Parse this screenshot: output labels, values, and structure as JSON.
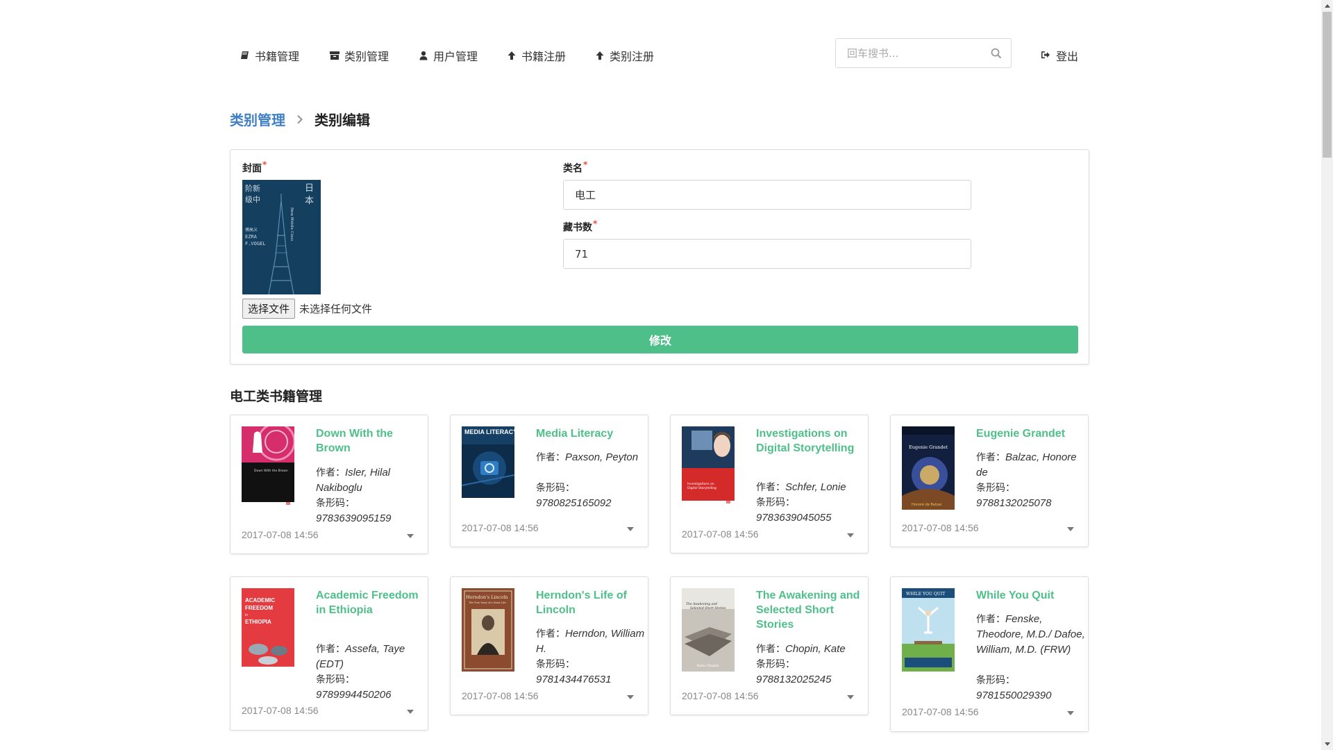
{
  "nav": {
    "items": [
      {
        "label": "书籍管理",
        "icon": "book-icon"
      },
      {
        "label": "类别管理",
        "icon": "archive-icon"
      },
      {
        "label": "用户管理",
        "icon": "user-icon"
      },
      {
        "label": "书籍注册",
        "icon": "arrow-up-icon"
      },
      {
        "label": "类别注册",
        "icon": "arrow-up-icon"
      }
    ],
    "search_placeholder": "回车搜书...",
    "logout_label": "登出"
  },
  "breadcrumb": {
    "parent": "类别管理",
    "current": "类别编辑"
  },
  "form": {
    "cover_label": "封面",
    "file_button": "选择文件",
    "file_status": "未选择任何文件",
    "name_label": "类名",
    "name_value": "电工",
    "count_label": "藏书数",
    "count_value": "71",
    "submit_label": "修改",
    "required_mark": "*",
    "cover_text": {
      "cn_title": "日本新中产阶级",
      "en_title": "Japan's New Middle Class",
      "author": "EZRA F.VOGEL",
      "author_cn": "傅高义"
    }
  },
  "section_title": "电工类书籍管理",
  "labels": {
    "author": "作者：",
    "barcode": "条形码："
  },
  "books": [
    {
      "title": "Down With the Brown",
      "author": "Isler, Hilal Nakiboglu",
      "barcode": "9783639095159",
      "date": "2017-07-08 14:56"
    },
    {
      "title": "Media Literacy",
      "author": "Paxson, Peyton",
      "barcode": "9780825165092",
      "date": "2017-07-08 14:56"
    },
    {
      "title": "Investigations on Digital Storytelling",
      "author": "Schfer, Lonie",
      "barcode": "9783639045055",
      "date": "2017-07-08 14:56"
    },
    {
      "title": "Eugenie Grandet",
      "author": "Balzac, Honore de",
      "barcode": "9788132025078",
      "date": "2017-07-08 14:56"
    },
    {
      "title": "Academic Freedom in Ethiopia",
      "author": "Assefa, Taye (EDT)",
      "barcode": "9789994450206",
      "date": "2017-07-08 14:56"
    },
    {
      "title": "Herndon's Life of Lincoln",
      "author": "Herndon, William H.",
      "barcode": "9781434476531",
      "date": "2017-07-08 14:56"
    },
    {
      "title": "The Awakening and Selected Short Stories",
      "author": "Chopin, Kate",
      "barcode": "9788132025245",
      "date": "2017-07-08 14:56"
    },
    {
      "title": "While You Quit",
      "author": "Fenske, Theodore, M.D./ Dafoe, William, M.D. (FRW)",
      "barcode": "9781550029390",
      "date": "2017-07-08 14:56"
    }
  ],
  "covers": {
    "media_literacy": "MEDIA LITERACY",
    "herndon": "Herndon's Lincoln",
    "herndon_sub": "The True Story of a Great Life",
    "academic": "ACADEMIC FREEDOM in ETHIOPIA",
    "awakening": "The Awakening and Selected Short Stories",
    "awakening_author": "Kate Chopin",
    "while": "WHILE YOU QUIT",
    "eugenie": "Eugenie Grandet",
    "down": "Down With the Brown"
  },
  "colors": {
    "accent": "#4fbf89",
    "link": "#3f7fc4",
    "required": "#e74c3c"
  }
}
